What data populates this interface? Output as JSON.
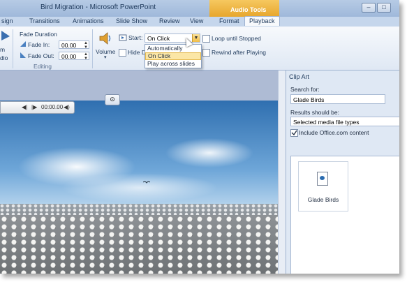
{
  "window": {
    "title": "Bird Migration - Microsoft PowerPoint",
    "contextual_tab": "Audio Tools"
  },
  "tabs": [
    "sign",
    "Transitions",
    "Animations",
    "Slide Show",
    "Review",
    "View",
    "Format",
    "Playback"
  ],
  "active_tab": "Playback",
  "ribbon": {
    "left_partial_labels": [
      "m",
      "dio"
    ],
    "fade_duration_label": "Fade Duration",
    "fade_in_label": "Fade In:",
    "fade_in_value": "00.00",
    "fade_out_label": "Fade Out:",
    "fade_out_value": "00.00",
    "editing_group": "Editing",
    "volume_label": "Volume",
    "start_label": "Start:",
    "start_value": "On Click",
    "hide_label": "Hide D",
    "loop_label": "Loop until Stopped",
    "rewind_label": "Rewind after Playing",
    "start_options": [
      "Automatically",
      "On Click",
      "Play across slides"
    ],
    "start_highlighted": "On Click"
  },
  "player": {
    "time": "00:00.00"
  },
  "clip_art": {
    "title": "Clip Art",
    "search_label": "Search for:",
    "search_value": "Glade Birds",
    "results_label": "Results should be:",
    "results_value": "Selected media file types",
    "include_office": "Include Office.com content",
    "include_checked": true,
    "result_name": "Glade Birds"
  },
  "colors": {
    "accent_contextual": "#e7a62d",
    "ribbon_bg": "#dfe8f4",
    "highlight": "#fbe6a6"
  }
}
